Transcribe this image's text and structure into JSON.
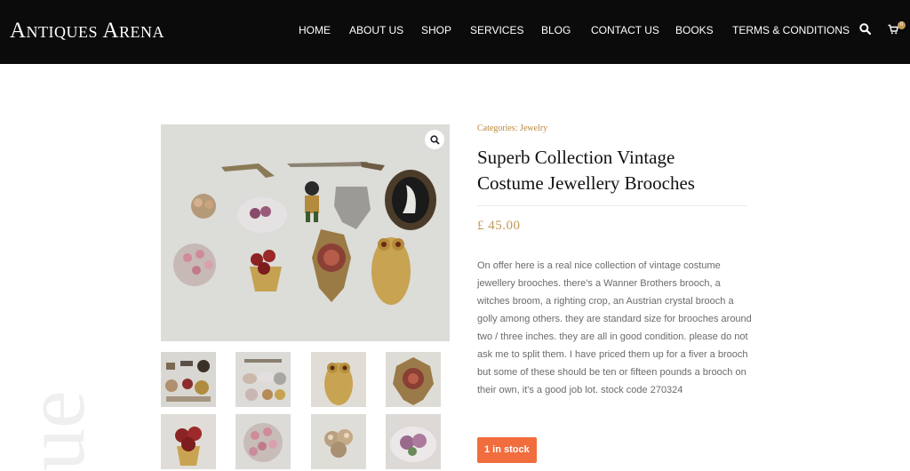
{
  "header": {
    "logo": "Antiques Arena",
    "nav": [
      "HOME",
      "ABOUT US",
      "SHOP",
      "SERVICES",
      "BLOG",
      "CONTACT US",
      "BOOKS",
      "TERMS & CONDITIONS"
    ],
    "cart_count": "0",
    "icons": {
      "search": "search-icon",
      "cart": "cart-icon"
    }
  },
  "watermark": "ue",
  "product": {
    "categories_label": "Categories:",
    "category": "Jewelry",
    "title": "Superb Collection Vintage Costume Jewellery Brooches",
    "price": "£ 45.00",
    "description": "On offer here is a real nice collection of vintage costume jewellery brooches. there's a Wanner Brothers brooch, a witches broom, a righting crop, an Austrian crystal brooch a golly among others. they are standard size for brooches around two / three inches. they are all in good condition. please do not ask me to split them. I have priced them up for a fiver a brooch but some of these should be ten or fifteen pounds a brooch on their own, it's a good job lot. stock code 270324",
    "stock": "1 in stock"
  },
  "colors": {
    "header_bg": "#0b0b0b",
    "accent_gold": "#c39a55",
    "stock_orange": "#f26d3d"
  }
}
